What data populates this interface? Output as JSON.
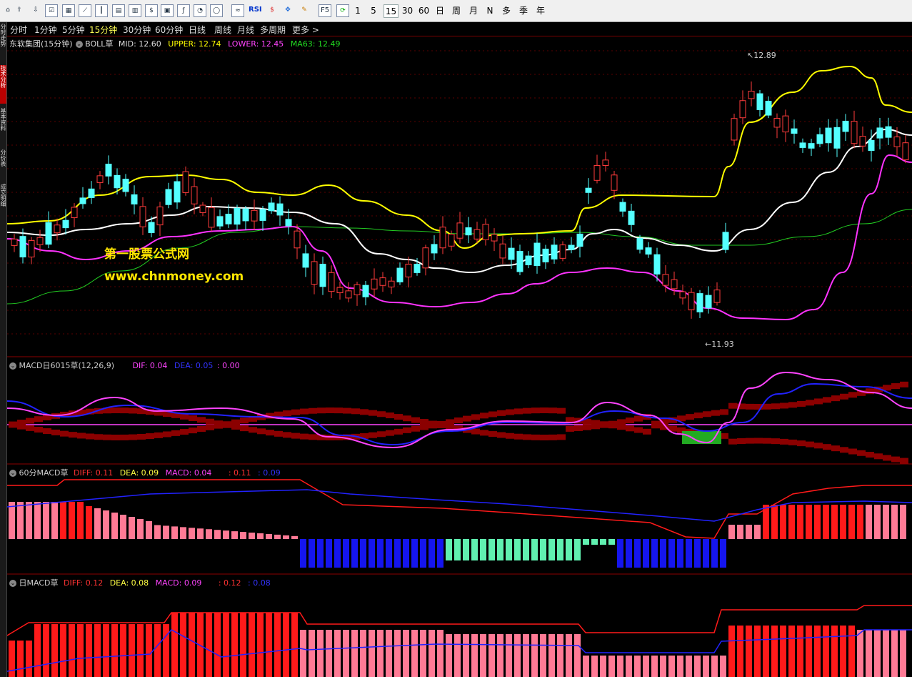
{
  "toolbar": {
    "icons": [
      "home-icon",
      "up-arrow-icon",
      "down-arrow-icon",
      "checklist-icon",
      "table-icon",
      "line-chart-icon",
      "candlestick-icon",
      "data-grid-icon",
      "data-f10-icon",
      "dollar-icon",
      "report-icon",
      "formula-icon",
      "funds-icon",
      "circle-icon",
      "trend-icon",
      "rsi-icon",
      "dollar-red-icon",
      "crosshair-move-icon",
      "pencil-icon"
    ],
    "rsi_label": "RSI",
    "f5_label": "F5",
    "periods": [
      "1",
      "5",
      "15",
      "30",
      "60",
      "日",
      "周",
      "月",
      "N",
      "多",
      "季",
      "年"
    ],
    "selected_period": "15"
  },
  "side_tabs": [
    "分时走势",
    "技术分析",
    "基本资料",
    "分价表",
    "成交明细"
  ],
  "periods": {
    "items": [
      "分时",
      "1分钟",
      "5分钟",
      "15分钟",
      "30分钟",
      "60分钟",
      "日线",
      "周线",
      "月线",
      "多周期",
      "更多 >"
    ],
    "active": "15分钟"
  },
  "main_panel": {
    "title": "东软集团(15分钟)",
    "indicator_name": "BOLL草",
    "mid": "MID: 12.60",
    "upper": "UPPER: 12.74",
    "lower": "LOWER: 12.45",
    "ma63": "MA63: 12.49",
    "high_label": "12.89",
    "low_label": "11.93",
    "watermark_name": "第一股票公式网",
    "watermark_url": "www.chnmoney.com"
  },
  "macd1": {
    "name": "MACD日6015草(12,26,9)",
    "dif": "DIF: 0.04",
    "dea": "DEA: 0.05",
    "extra": ": 0.00"
  },
  "macd2": {
    "name": "60分MACD草",
    "diff": "DIFF: 0.11",
    "dea": "DEA: 0.09",
    "macd": "MACD: 0.04",
    "v1": ": 0.11",
    "v2": ": 0.09"
  },
  "macd3": {
    "name": "日MACD草",
    "diff": "DIFF: 0.12",
    "dea": "DEA: 0.08",
    "macd": "MACD: 0.09",
    "v1": ": 0.12",
    "v2": ": 0.08"
  },
  "colors": {
    "up": "#ff3b3b",
    "down": "#54ffff",
    "boll_upper": "#ffff00",
    "boll_mid": "#ffffff",
    "boll_lower": "#ff33ff",
    "ma63": "#22cc22",
    "dif": "#ff44ff",
    "dea": "#2222ff",
    "dark_red": "#8b0000",
    "hist_red": "#ff1a1a",
    "hist_pink": "#ff7a95",
    "hist_blue": "#1515ee",
    "hist_mint": "#60f0b0",
    "green_fill": "#22aa22",
    "divider": "#8b0000"
  }
}
